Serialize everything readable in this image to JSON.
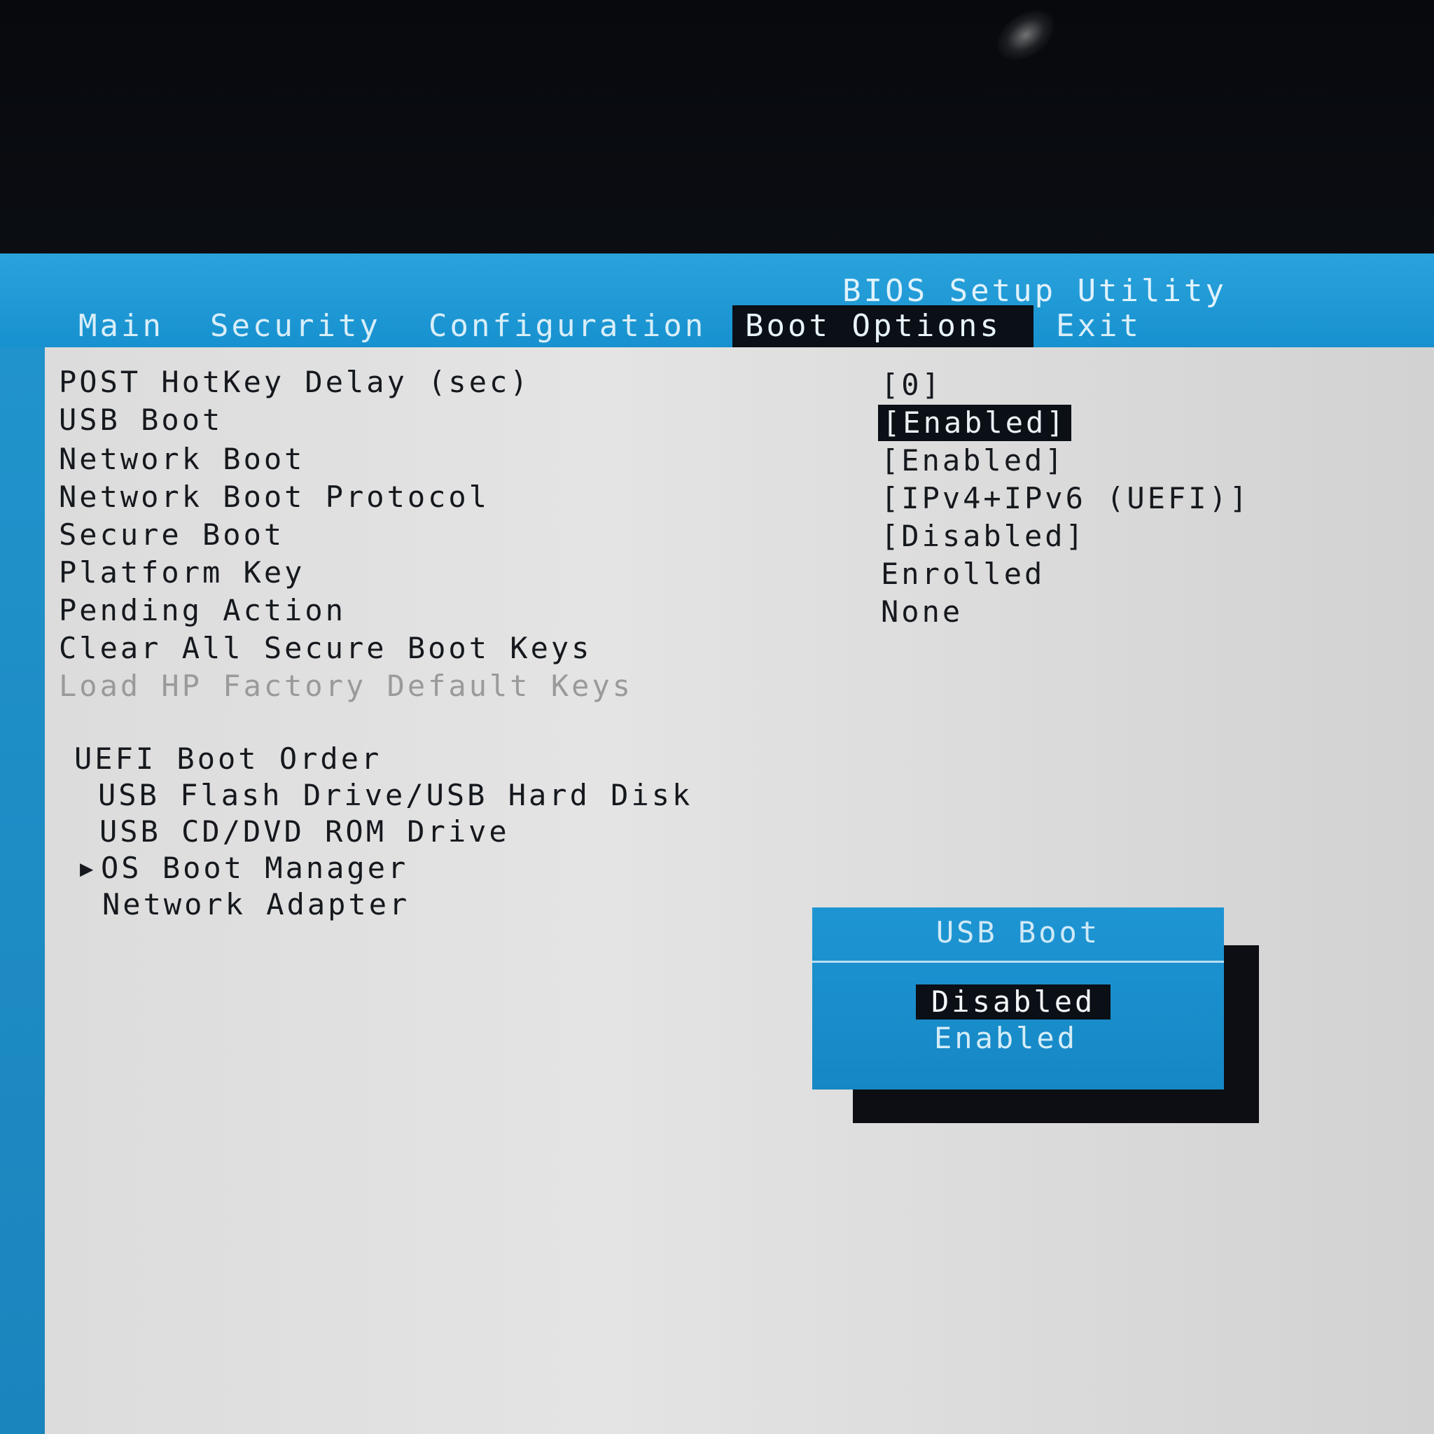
{
  "header": {
    "utility_title": "BIOS Setup Utility",
    "tabs": [
      {
        "label": "Main",
        "active": false
      },
      {
        "label": "Security",
        "active": false
      },
      {
        "label": "Configuration",
        "active": false
      },
      {
        "label": "Boot Options",
        "active": true
      },
      {
        "label": "Exit",
        "active": false
      }
    ]
  },
  "settings": [
    {
      "label": "POST HotKey Delay (sec)",
      "value": "[0]"
    },
    {
      "label": "USB Boot",
      "value": "[Enabled]",
      "selected": true
    },
    {
      "label": "Network Boot",
      "value": "[Enabled]"
    },
    {
      "label": "Network Boot Protocol",
      "value": "[IPv4+IPv6 (UEFI)]"
    },
    {
      "label": "Secure Boot",
      "value": "[Disabled]"
    },
    {
      "label": "Platform Key",
      "value": "Enrolled"
    },
    {
      "label": "Pending Action",
      "value": "None"
    },
    {
      "label": "Clear All Secure Boot Keys"
    },
    {
      "label": "Load HP Factory Default Keys",
      "disabled": true
    }
  ],
  "boot_order": {
    "title": "UEFI Boot Order",
    "items": [
      {
        "label": "USB Flash Drive/USB Hard Disk"
      },
      {
        "label": "USB CD/DVD ROM Drive"
      },
      {
        "label": "OS Boot Manager",
        "expandable": true
      },
      {
        "label": "Network Adapter"
      }
    ]
  },
  "popup": {
    "title": "USB Boot",
    "options": [
      {
        "label": "Disabled",
        "selected": true
      },
      {
        "label": "Enabled",
        "selected": false
      }
    ]
  },
  "colors": {
    "header_blue": "#1a8fcc",
    "panel_gray": "#dcdcdc",
    "selection_black": "#0b0f16",
    "popup_blue": "#1e95d3"
  }
}
